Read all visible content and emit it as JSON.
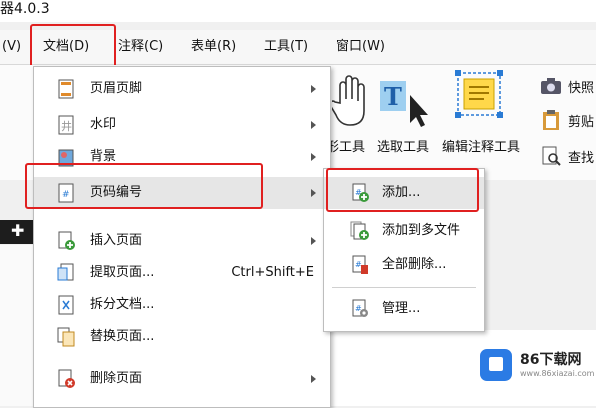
{
  "window": {
    "title": "器4.0.3"
  },
  "menubar": {
    "items": [
      {
        "label": "(V)"
      },
      {
        "label": "文档(D)"
      },
      {
        "label": "注释(C)"
      },
      {
        "label": "表单(R)"
      },
      {
        "label": "工具(T)"
      },
      {
        "label": "窗口(W)"
      }
    ]
  },
  "toolbar": {
    "labels": [
      "形工具",
      "选取工具",
      "编辑注释工具",
      "快照",
      "剪贴",
      "查找"
    ]
  },
  "doc_menu": {
    "items": [
      {
        "label": "页眉页脚",
        "icon": "header-footer-icon",
        "submenu": true
      },
      {
        "label": "水印",
        "icon": "watermark-icon",
        "submenu": true
      },
      {
        "label": "背景",
        "icon": "background-icon",
        "submenu": true
      },
      {
        "label": "页码编号",
        "icon": "page-number-icon",
        "submenu": true
      },
      {
        "label": "插入页面",
        "icon": "insert-page-icon",
        "submenu": true
      },
      {
        "label": "提取页面...",
        "icon": "extract-page-icon",
        "shortcut": "Ctrl+Shift+E"
      },
      {
        "label": "拆分文档...",
        "icon": "split-document-icon"
      },
      {
        "label": "替换页面...",
        "icon": "replace-page-icon"
      },
      {
        "label": "删除页面",
        "icon": "delete-page-icon",
        "submenu": true
      }
    ]
  },
  "page_number_submenu": {
    "items": [
      {
        "label": "添加...",
        "icon": "add-page-number-icon"
      },
      {
        "label": "添加到多文件",
        "icon": "add-to-multiple-files-icon"
      },
      {
        "label": "全部删除...",
        "icon": "delete-all-icon"
      },
      {
        "label": "管理...",
        "icon": "manage-icon"
      }
    ]
  },
  "watermark": {
    "brand": "86下载网",
    "site": "www.86xiazai.com"
  },
  "colors": {
    "highlight_box": "#e02020",
    "menu_hover": "#e6e6e6"
  }
}
